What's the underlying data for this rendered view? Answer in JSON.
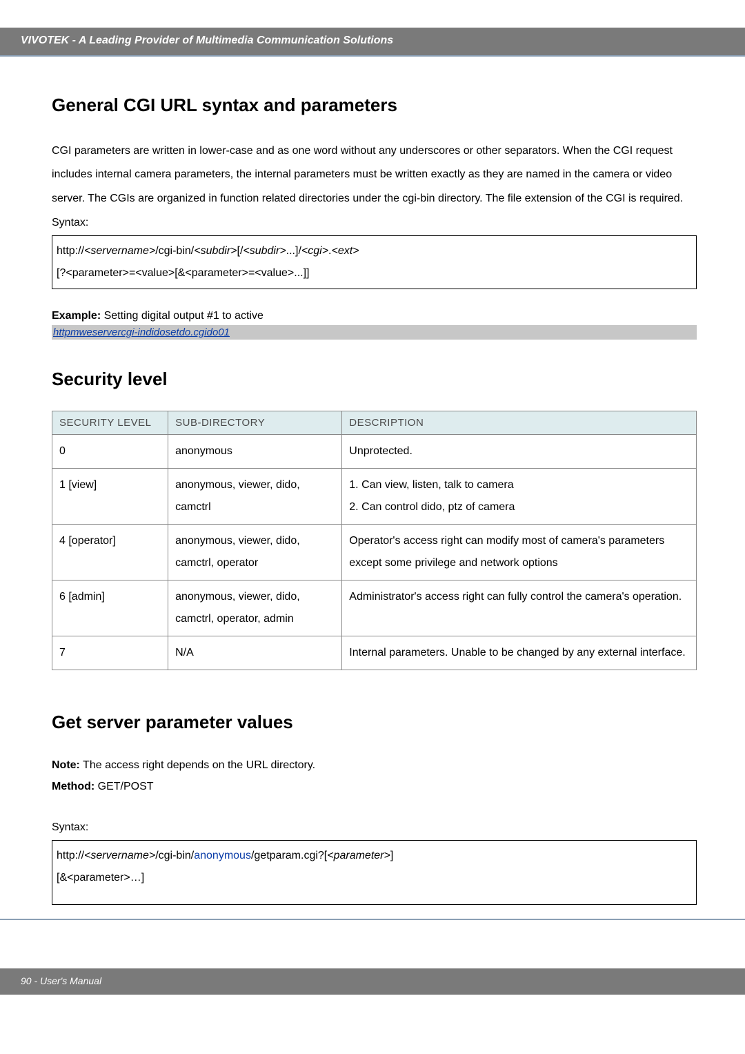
{
  "header": {
    "brand": "VIVOTEK - A Leading Provider of Multimedia Communication Solutions"
  },
  "section1": {
    "title": "General CGI URL syntax and parameters",
    "para": "CGI parameters are written in lower-case and as one word without any underscores or other separators. When the CGI request includes internal camera parameters, the internal parameters must be written exactly as they are named in the camera or video server. The CGIs are organized in function related directories under the cgi-bin directory. The file extension of the CGI is required.",
    "syntax_label": "Syntax:",
    "syntax_line1_a": "http://",
    "syntax_line1_b": "<servername>",
    "syntax_line1_c": "/cgi-bin/",
    "syntax_line1_d": "<subdir>",
    "syntax_line1_e": "[/",
    "syntax_line1_f": "<subdir>",
    "syntax_line1_g": "...]/",
    "syntax_line1_h": "<cgi>",
    "syntax_line1_i": ".",
    "syntax_line1_j": "<ext>",
    "syntax_line2": "[?<parameter>=<value>[&<parameter>=<value>...]]",
    "example_label": "Example:",
    "example_text": " Setting digital output #1 to active",
    "example_url": "httpmweservercgi-indidosetdo.cgido01"
  },
  "section2": {
    "title": "Security level",
    "headers": [
      "SECURITY LEVEL",
      "SUB-DIRECTORY",
      "DESCRIPTION"
    ],
    "rows": [
      {
        "level": "0",
        "subdir": "anonymous",
        "desc": "Unprotected."
      },
      {
        "level": "1 [view]",
        "subdir": "anonymous, viewer, dido, camctrl",
        "desc": "1. Can view, listen, talk to camera\n2. Can control dido, ptz of camera"
      },
      {
        "level": "4 [operator]",
        "subdir": "anonymous, viewer, dido, camctrl, operator",
        "desc": "Operator's access right can modify most of camera's parameters except some privilege and network options"
      },
      {
        "level": "6 [admin]",
        "subdir": "anonymous, viewer, dido, camctrl, operator, admin",
        "desc": "Administrator's access right can fully control the camera's operation."
      },
      {
        "level": "7",
        "subdir": "N/A",
        "desc": "Internal parameters. Unable to be changed by any external interface."
      }
    ]
  },
  "section3": {
    "title": "Get server parameter values",
    "note_label": "Note:",
    "note_text": " The access right depends on the URL directory.",
    "method_label": "Method:",
    "method_text": " GET/POST",
    "syntax_label": "Syntax:",
    "line1_a": "http://",
    "line1_b": "<servername>",
    "line1_c": "/cgi-bin/",
    "line1_d": "anonymous",
    "line1_e": "/getparam.cgi?[",
    "line1_f": "<parameter>",
    "line1_g": "]",
    "line2": "[&<parameter>…]"
  },
  "footer": {
    "text": "90 - User's Manual"
  }
}
